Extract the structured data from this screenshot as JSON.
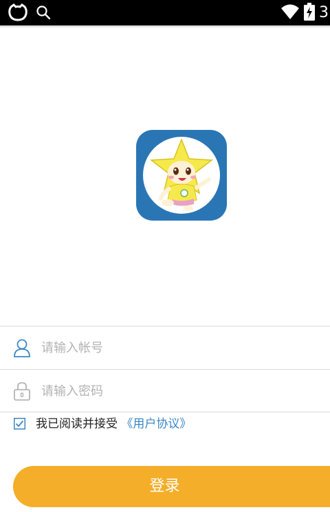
{
  "status_bar": {
    "time": "3",
    "icons": [
      "cat-face-icon",
      "search-icon",
      "wifi-icon",
      "battery-charging-icon"
    ]
  },
  "app": {
    "logo": "star-mascot-logo"
  },
  "form": {
    "account": {
      "placeholder": "请输入帐号",
      "value": "",
      "icon": "user-icon"
    },
    "password": {
      "placeholder": "请输入密码",
      "value": "",
      "icon": "lock-icon"
    },
    "agreement": {
      "checked": true,
      "text": "我已阅读并接受",
      "link": "《用户协议》"
    },
    "login_label": "登录"
  },
  "colors": {
    "accent": "#3b86c6",
    "button": "#f4ae2a",
    "logo_bg": "#2a76b5"
  }
}
